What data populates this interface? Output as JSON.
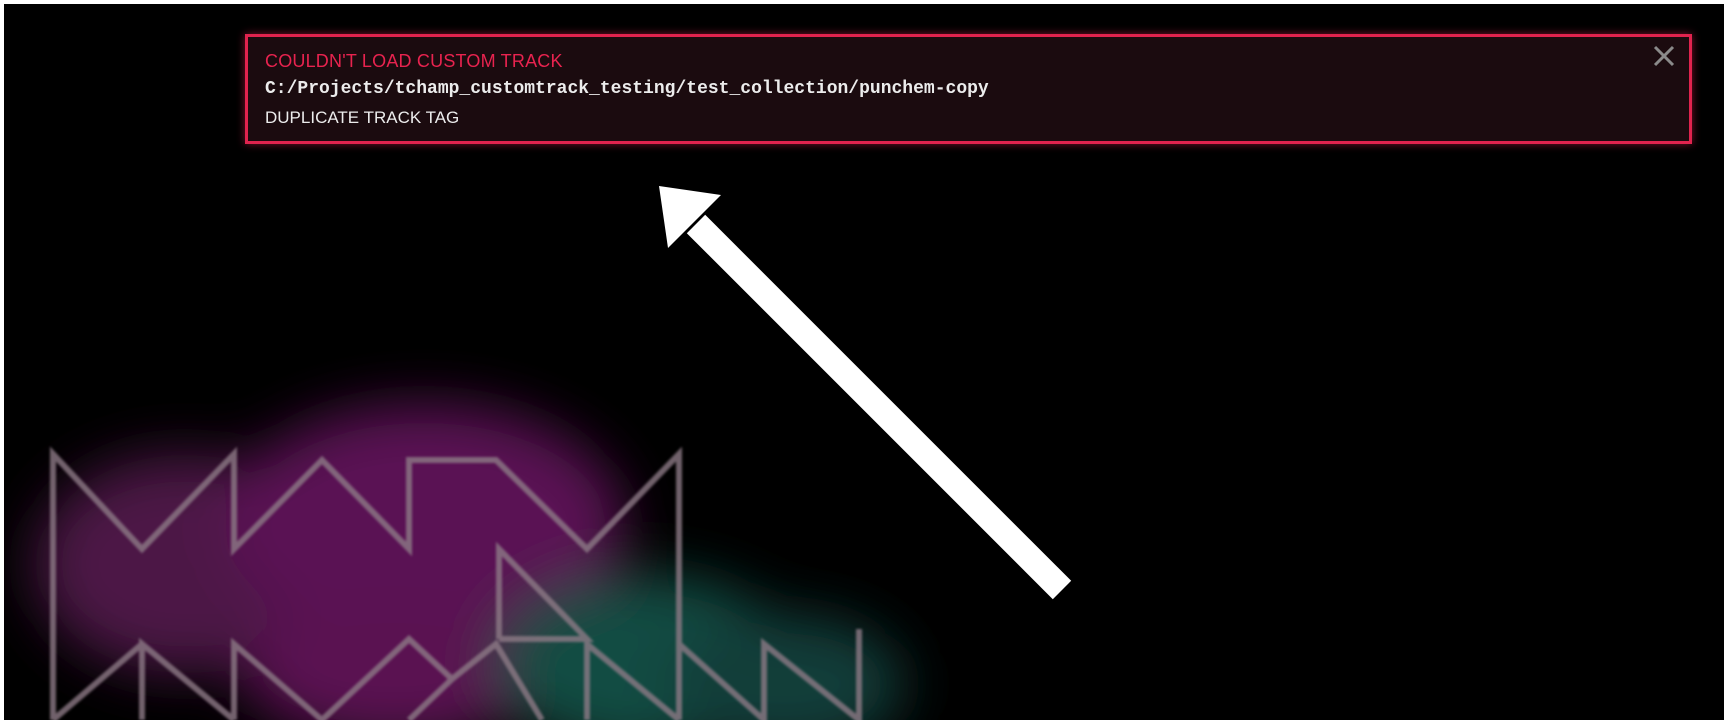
{
  "error_toast": {
    "title": "COULDN'T LOAD CUSTOM TRACK",
    "path": "C:/Projects/tchamp_customtrack_testing/test_collection/punchem-copy",
    "reason": "DUPLICATE TRACK TAG",
    "close_icon": "close-icon",
    "accent_color": "#e0234e"
  },
  "annotation": {
    "icon": "arrow-icon",
    "color": "#ffffff"
  },
  "background_art": {
    "icon": "neon-zigzag-logo",
    "colors": [
      "#8a2a7a",
      "#1e8a78"
    ]
  }
}
